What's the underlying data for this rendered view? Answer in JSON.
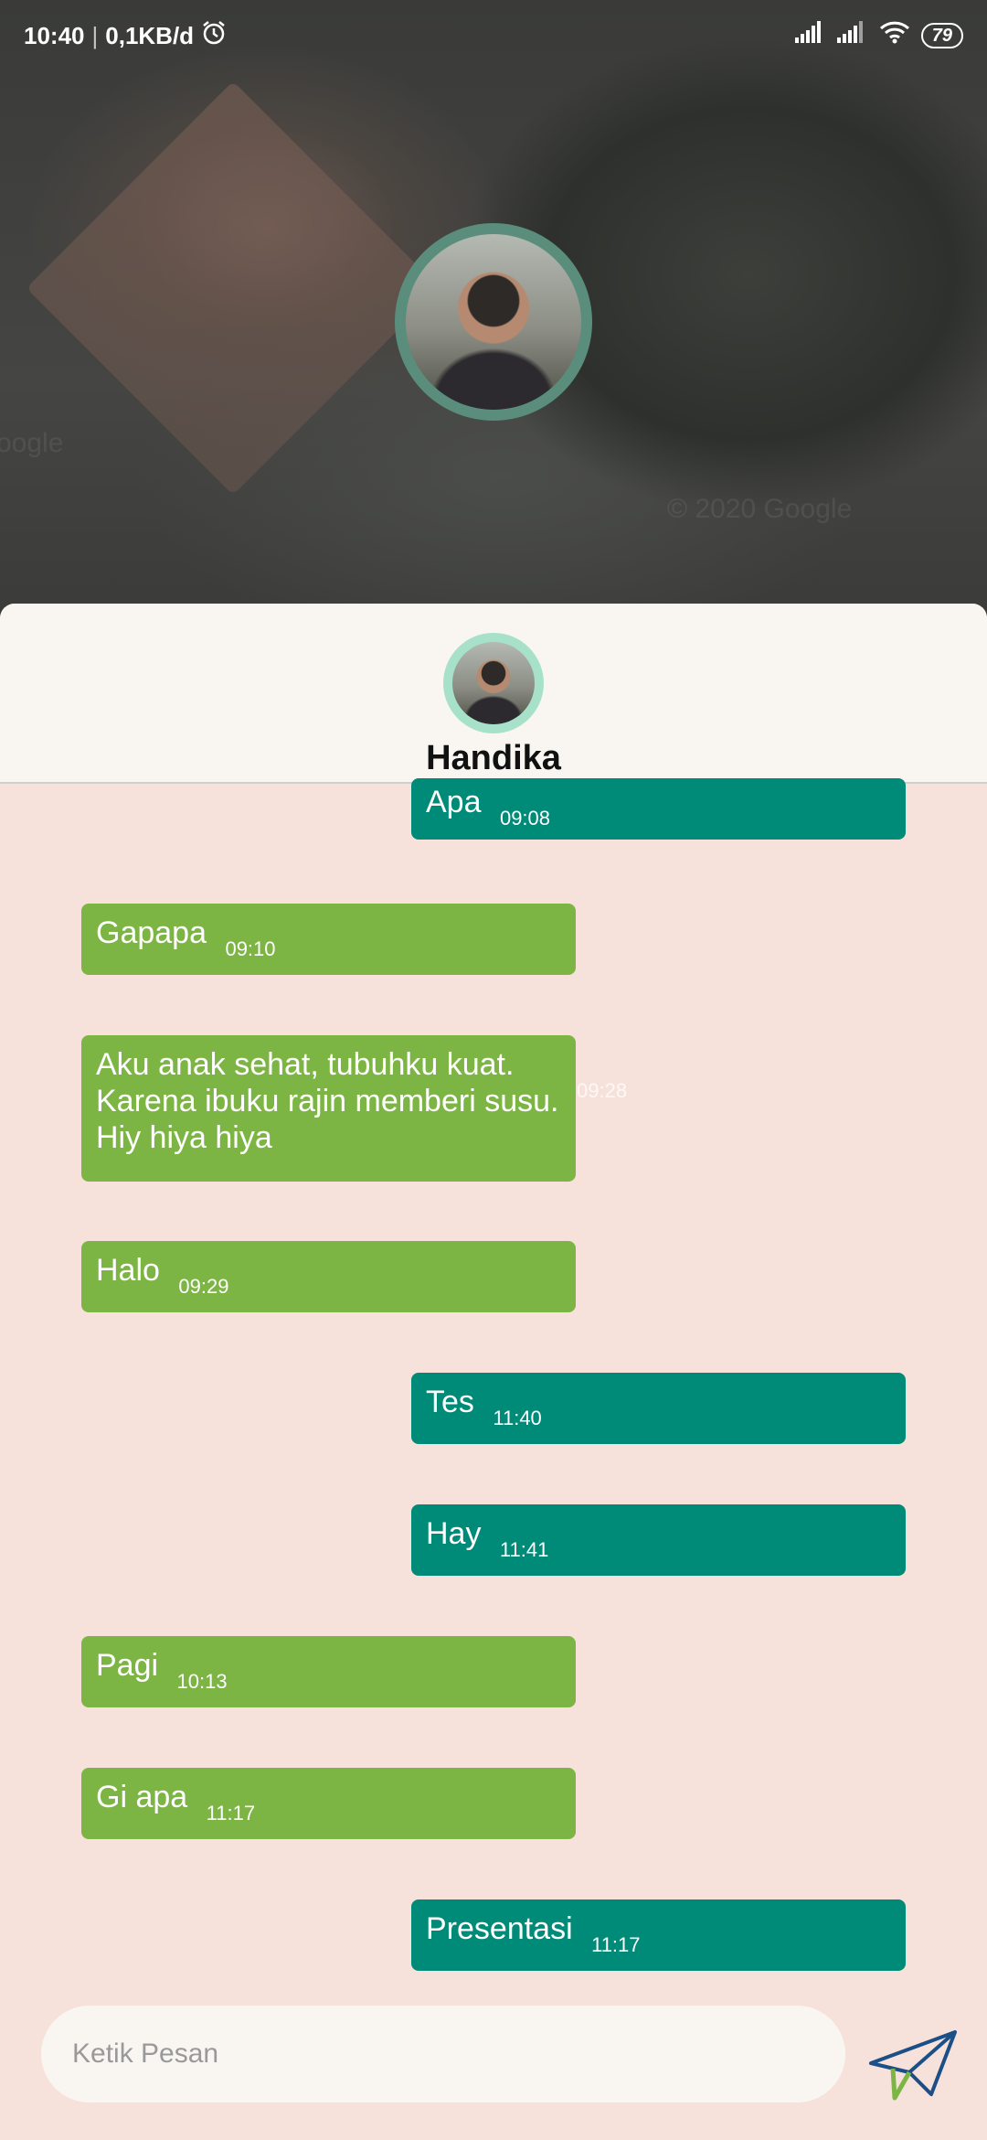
{
  "status_bar": {
    "time": "10:40",
    "network_speed": "0,1KB/d",
    "battery": "79",
    "icons": [
      "alarm-icon",
      "signal-icon",
      "signal-icon",
      "wifi-icon",
      "battery-icon"
    ]
  },
  "map": {
    "watermark_left": "oogle",
    "watermark_right": "© 2020 Google"
  },
  "contact": {
    "name": "Handika"
  },
  "messages": [
    {
      "side": "sent",
      "text": "Apa",
      "time": "09:08"
    },
    {
      "side": "received",
      "text": "Gapapa",
      "time": "09:10"
    },
    {
      "side": "received",
      "text": "Aku anak sehat, tubuhku kuat. Karena ibuku rajin memberi susu. Hiy hiya hiya",
      "time": "09:28"
    },
    {
      "side": "received",
      "text": "Halo",
      "time": "09:29"
    },
    {
      "side": "sent",
      "text": "Tes",
      "time": "11:40"
    },
    {
      "side": "sent",
      "text": "Hay",
      "time": "11:41"
    },
    {
      "side": "received",
      "text": "Pagi",
      "time": "10:13"
    },
    {
      "side": "received",
      "text": "Gi apa",
      "time": "11:17"
    },
    {
      "side": "sent",
      "text": "Presentasi",
      "time": "11:17"
    }
  ],
  "composer": {
    "placeholder": "Ketik Pesan"
  },
  "colors": {
    "sent_bubble": "#008a78",
    "received_bubble": "#7db544",
    "chat_background": "#f7e1db",
    "header_background": "#f9f6f1"
  }
}
